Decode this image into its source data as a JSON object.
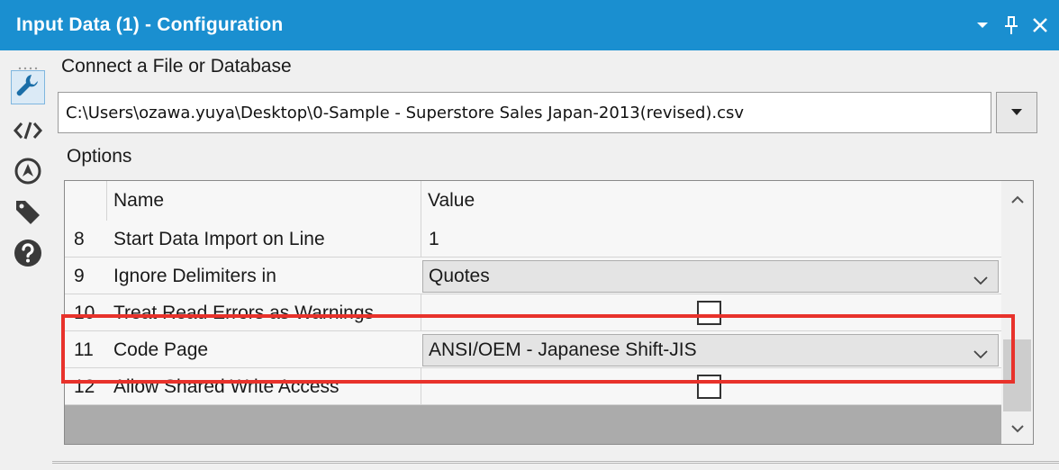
{
  "window": {
    "title": "Input Data (1) - Configuration",
    "controls": [
      "dropdown-arrow-icon",
      "pin-icon",
      "close-icon"
    ],
    "accent_color": "#1a8fd0"
  },
  "sidebar": {
    "tools": [
      {
        "icon": "wrench-icon",
        "active": true
      },
      {
        "icon": "code-icon",
        "active": false
      },
      {
        "icon": "navigator-icon",
        "active": false
      },
      {
        "icon": "tag-icon",
        "active": false
      },
      {
        "icon": "help-icon",
        "active": false
      }
    ]
  },
  "connect": {
    "label": "Connect a File or Database",
    "path": "C:\\Users\\ozawa.yuya\\Desktop\\0-Sample - Superstore Sales Japan-2013(revised).csv"
  },
  "options": {
    "label": "Options",
    "columns": {
      "name": "Name",
      "value": "Value"
    },
    "rows": [
      {
        "num": "8",
        "name": "Start Data Import on Line",
        "type": "text",
        "value": "1"
      },
      {
        "num": "9",
        "name": "Ignore Delimiters in",
        "type": "combo",
        "value": "Quotes"
      },
      {
        "num": "10",
        "name": "Treat Read Errors as Warnings",
        "type": "checkbox",
        "checked": false
      },
      {
        "num": "11",
        "name": "Code Page",
        "type": "combo",
        "value": "ANSI/OEM - Japanese Shift-JIS"
      },
      {
        "num": "12",
        "name": "Allow Shared Write Access",
        "type": "checkbox",
        "checked": false
      }
    ]
  },
  "highlight_color": "#e8322b"
}
